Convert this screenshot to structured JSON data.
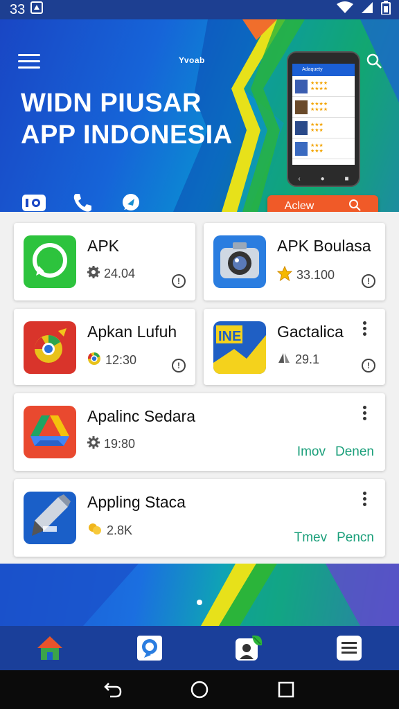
{
  "status_bar": {
    "time": "33"
  },
  "header": {
    "brand": "Yvoab",
    "title_line1": "WIDN PIUSAR",
    "title_line2": "APP INDONESIA",
    "cta_label": "Aclew"
  },
  "apps": [
    {
      "name": "APK",
      "meta": "24.04",
      "meta_icon": "gear-icon"
    },
    {
      "name": "APK Boulasa",
      "meta": "33.100",
      "meta_icon": "star-icon"
    },
    {
      "name": "Apkan Lufuh",
      "meta": "12:30",
      "meta_icon": "chrome-icon"
    },
    {
      "name": "Gactalica",
      "meta": "29.1",
      "meta_icon": "arrows-icon"
    },
    {
      "name": "Apalinc Sedara",
      "meta": "19:80",
      "meta_icon": "gear-icon",
      "link1": "Imov",
      "link2": "Denen"
    },
    {
      "name": "Appling Staca",
      "meta": "2.8K",
      "meta_icon": "coins-icon",
      "link1": "Tmev",
      "link2": "Pencn"
    }
  ],
  "colors": {
    "accent": "#f05a28",
    "brand_blue": "#1a3f9a",
    "link_green": "#1a9f7a"
  }
}
